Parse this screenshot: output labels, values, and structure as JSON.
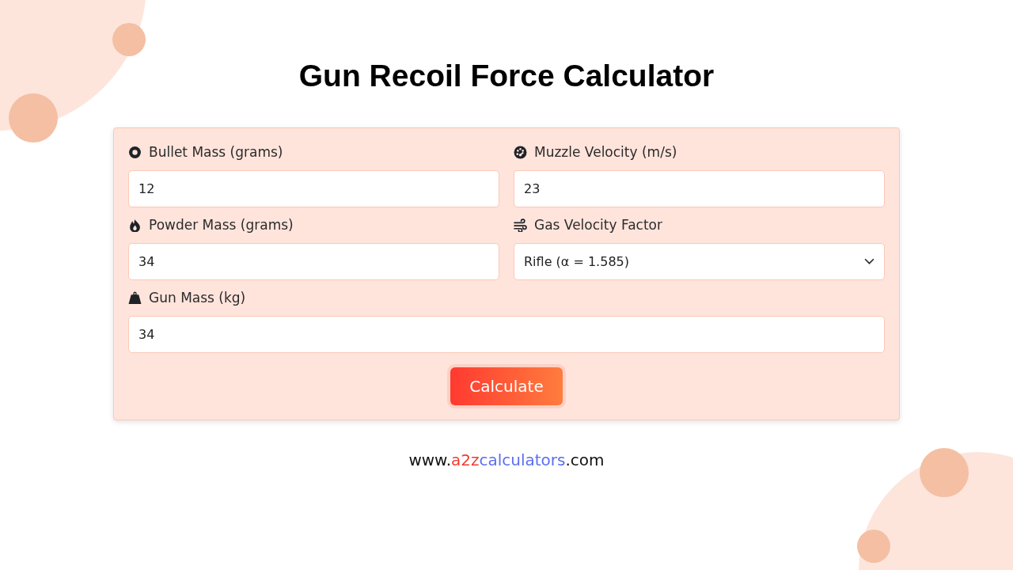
{
  "title": "Gun Recoil Force Calculator",
  "fields": [
    {
      "kind": "input",
      "label": "Bullet Mass (grams)",
      "value": "12",
      "wide": false
    },
    {
      "kind": "input",
      "label": "Muzzle Velocity (m/s)",
      "value": "23",
      "wide": false
    },
    {
      "kind": "input",
      "label": "Powder Mass (grams)",
      "value": "34",
      "wide": false
    },
    {
      "kind": "select",
      "label": "Gas Velocity Factor",
      "value": "Rifle (α = 1.585)",
      "wide": false
    },
    {
      "kind": "input",
      "label": "Gun Mass (kg)",
      "value": "34",
      "wide": true
    }
  ],
  "button": "Calculate",
  "footer": [
    {
      "text": "www.",
      "color": "#111111"
    },
    {
      "text": "a2z",
      "color": "#f23b2f"
    },
    {
      "text": "calculators",
      "color": "#5b6ff0"
    },
    {
      "text": ".com",
      "color": "#111111"
    }
  ]
}
